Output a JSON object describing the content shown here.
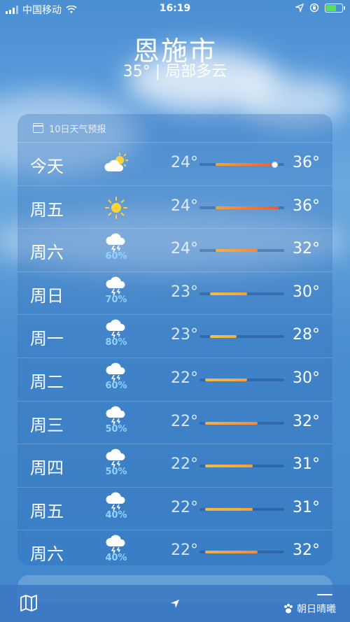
{
  "status_bar": {
    "carrier": "中国移动",
    "time": "16:19"
  },
  "header": {
    "city": "恩施市",
    "current": "35° | 局部多云"
  },
  "forecast": {
    "title": "10日天气预报",
    "days": [
      {
        "day": "今天",
        "icon": "partly-cloudy-sun-icon",
        "precip": "",
        "low": "24°",
        "high": "36°",
        "range": [
          24,
          36
        ],
        "current": 35
      },
      {
        "day": "周五",
        "icon": "sun-icon",
        "precip": "",
        "low": "24°",
        "high": "36°",
        "range": [
          24,
          36
        ]
      },
      {
        "day": "周六",
        "icon": "thunderstorm-icon",
        "precip": "60%",
        "low": "24°",
        "high": "32°",
        "range": [
          24,
          32
        ]
      },
      {
        "day": "周日",
        "icon": "thunderstorm-icon",
        "precip": "70%",
        "low": "23°",
        "high": "30°",
        "range": [
          23,
          30
        ]
      },
      {
        "day": "周一",
        "icon": "thunderstorm-icon",
        "precip": "80%",
        "low": "23°",
        "high": "28°",
        "range": [
          23,
          28
        ]
      },
      {
        "day": "周二",
        "icon": "thunderstorm-icon",
        "precip": "60%",
        "low": "22°",
        "high": "30°",
        "range": [
          22,
          30
        ]
      },
      {
        "day": "周三",
        "icon": "thunderstorm-icon",
        "precip": "50%",
        "low": "22°",
        "high": "32°",
        "range": [
          22,
          32
        ]
      },
      {
        "day": "周四",
        "icon": "thunderstorm-icon",
        "precip": "50%",
        "low": "22°",
        "high": "31°",
        "range": [
          22,
          31
        ]
      },
      {
        "day": "周五",
        "icon": "thunderstorm-icon",
        "precip": "40%",
        "low": "22°",
        "high": "31°",
        "range": [
          22,
          31
        ]
      },
      {
        "day": "周六",
        "icon": "thunderstorm-icon",
        "precip": "40%",
        "low": "22°",
        "high": "32°",
        "range": [
          22,
          32
        ]
      }
    ],
    "scale": [
      21,
      37
    ]
  },
  "toolbar": {
    "watermark": "朝日晴曦"
  },
  "colors": {
    "hot": "#f06a3a",
    "warm": "#f5a33a",
    "mild": "#f2c04a",
    "precip": "#8fd4ff"
  }
}
